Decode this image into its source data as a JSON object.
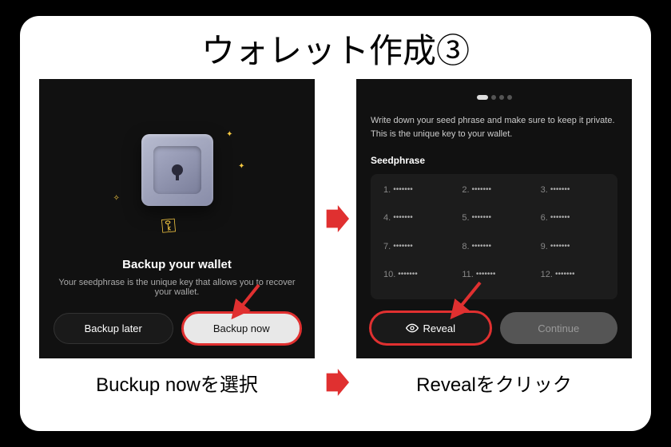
{
  "title": "ウォレット作成③",
  "left": {
    "heading": "Backup your wallet",
    "description": "Your seedphrase is the unique key that allows you to recover your wallet.",
    "backup_later": "Backup later",
    "backup_now": "Backup now"
  },
  "right": {
    "instruction": "Write down your seed phrase and make sure to keep it private. This is the unique key to your wallet.",
    "seedphrase_label": "Seedphrase",
    "mask": "•••••••",
    "seed_numbers": [
      "1.",
      "2.",
      "3.",
      "4.",
      "5.",
      "6.",
      "7.",
      "8.",
      "9.",
      "10.",
      "11.",
      "12."
    ],
    "reveal": "Reveal",
    "continue": "Continue"
  },
  "captions": {
    "left": "Buckup nowを選択",
    "right": "Revealをクリック"
  }
}
